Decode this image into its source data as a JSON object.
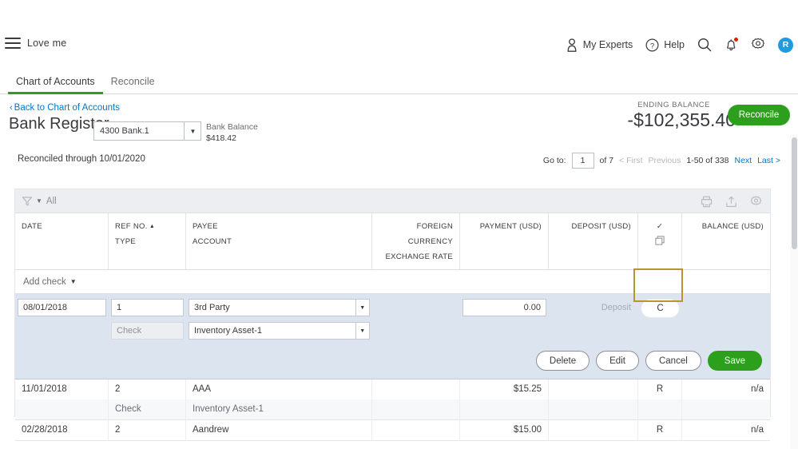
{
  "header": {
    "company": "Love me",
    "menu_icon": "hamburger-icon",
    "my_experts": "My Experts",
    "help": "Help",
    "search_icon": "search-icon",
    "bell_icon": "bell-icon",
    "gear_icon": "gear-icon",
    "avatar_initial": "R"
  },
  "tabs": [
    {
      "label": "Chart of Accounts",
      "active": true
    },
    {
      "label": "Reconcile",
      "active": false
    }
  ],
  "title": {
    "back_link": "Back to Chart of Accounts",
    "page_title": "Bank Register",
    "account_selected": "4300 Bank.1",
    "bank_balance_label": "Bank Balance",
    "bank_balance_value": "$418.42",
    "ending_balance_label": "ENDING BALANCE",
    "ending_balance_value": "-$102,355.40",
    "reconcile_button": "Reconcile"
  },
  "subbar": {
    "reconciled_through": "Reconciled through 10/01/2020",
    "goto_label": "Go to:",
    "goto_value": "1",
    "of_pages": "of 7",
    "first": "< First",
    "previous": "Previous",
    "range": "1-50 of 338",
    "next": "Next",
    "last": "Last >"
  },
  "toolbar": {
    "filter_icon": "funnel-icon",
    "filter_label": "All",
    "print_icon": "printer-icon",
    "export_icon": "export-icon",
    "settings_icon": "gear-icon"
  },
  "columns": {
    "date": "DATE",
    "ref_no": "REF NO.",
    "type": "TYPE",
    "payee": "PAYEE",
    "account": "ACCOUNT",
    "foreign_currency": "FOREIGN CURRENCY",
    "exchange_rate": "EXCHANGE RATE",
    "payment": "PAYMENT (USD)",
    "deposit": "DEPOSIT (USD)",
    "check_mark": "✓",
    "copy_icon": "copy-icon",
    "balance": "BALANCE (USD)"
  },
  "add_row": {
    "label": "Add check"
  },
  "edit_row": {
    "date": "08/01/2018",
    "ref_no": "1",
    "payee": "3rd Party",
    "type": "Check",
    "account": "Inventory Asset-1",
    "foreign_currency": "",
    "exchange_rate": "",
    "payment": "0.00",
    "deposit_placeholder": "Deposit",
    "status": "C",
    "balance": "",
    "buttons": {
      "delete": "Delete",
      "edit": "Edit",
      "cancel": "Cancel",
      "save": "Save"
    }
  },
  "rows": [
    {
      "date": "11/01/2018",
      "ref_no": "2",
      "payee": "AAA",
      "type": "Check",
      "account": "Inventory Asset-1",
      "foreign_currency": "",
      "exchange_rate": "",
      "payment": "$15.25",
      "deposit": "",
      "status": "R",
      "balance": "n/a"
    },
    {
      "date": "02/28/2018",
      "ref_no": "2",
      "payee": "Aandrew",
      "type": "",
      "account": "",
      "foreign_currency": "",
      "exchange_rate": "",
      "payment": "$15.00",
      "deposit": "",
      "status": "R",
      "balance": "n/a"
    }
  ],
  "colors": {
    "brand_green": "#2ca01c",
    "link_blue": "#0077c5",
    "highlight_gold": "#b8962e",
    "avatar_blue": "#1f9ce0",
    "edit_row_bg": "#dce4ef"
  }
}
